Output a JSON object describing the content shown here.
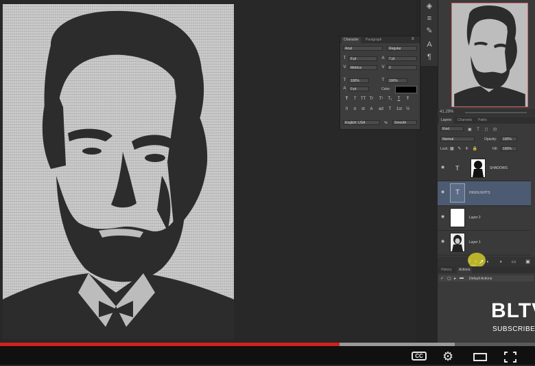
{
  "character_panel": {
    "tabs": [
      "Character",
      "Paragraph"
    ],
    "font_family": "Arial",
    "font_style": "Regular",
    "font_size": "8 pt",
    "leading": "7 pt",
    "kerning": "Metrics",
    "tracking": "0",
    "vertical_scale": "100%",
    "horizontal_scale": "100%",
    "baseline_shift": "0 pt",
    "color_label": "Color:",
    "typestyle_buttons": [
      "T",
      "T",
      "TT",
      "Tr",
      "T¹",
      "T₁",
      "T",
      "Ŧ"
    ],
    "opentype_buttons": [
      "fi",
      "σ",
      "st",
      "A",
      "ad",
      "T",
      "1st",
      "½"
    ],
    "language": "English: USA",
    "anti_alias_label": "ªa",
    "anti_alias": "Smooth"
  },
  "navigator": {
    "zoom": "41.29%"
  },
  "layers_panel": {
    "tabs": [
      "Layers",
      "Channels",
      "Paths"
    ],
    "filter_kind": "Kind",
    "blend_mode": "Normal",
    "opacity_label": "Opacity:",
    "opacity": "100%",
    "lock_label": "Lock:",
    "fill_label": "Fill:",
    "fill": "100%",
    "layers": [
      {
        "name": "SHADOWS",
        "type": "text",
        "selected": false
      },
      {
        "name": "HIGHLIGHTS",
        "type": "text",
        "selected": true
      },
      {
        "name": "Layer 2",
        "type": "white",
        "selected": false
      },
      {
        "name": "Layer 1",
        "type": "portrait",
        "selected": false
      }
    ]
  },
  "actions_panel": {
    "tabs": [
      "History",
      "Actions"
    ],
    "default_actions": "Default Actions"
  },
  "channel_logo": {
    "text": "BLTV",
    "subscribe": "SUBSCRIBE"
  },
  "video": {
    "progress": 0.635,
    "buffered": 0.85,
    "cc": "CC",
    "played_color": "#d61f1f"
  }
}
